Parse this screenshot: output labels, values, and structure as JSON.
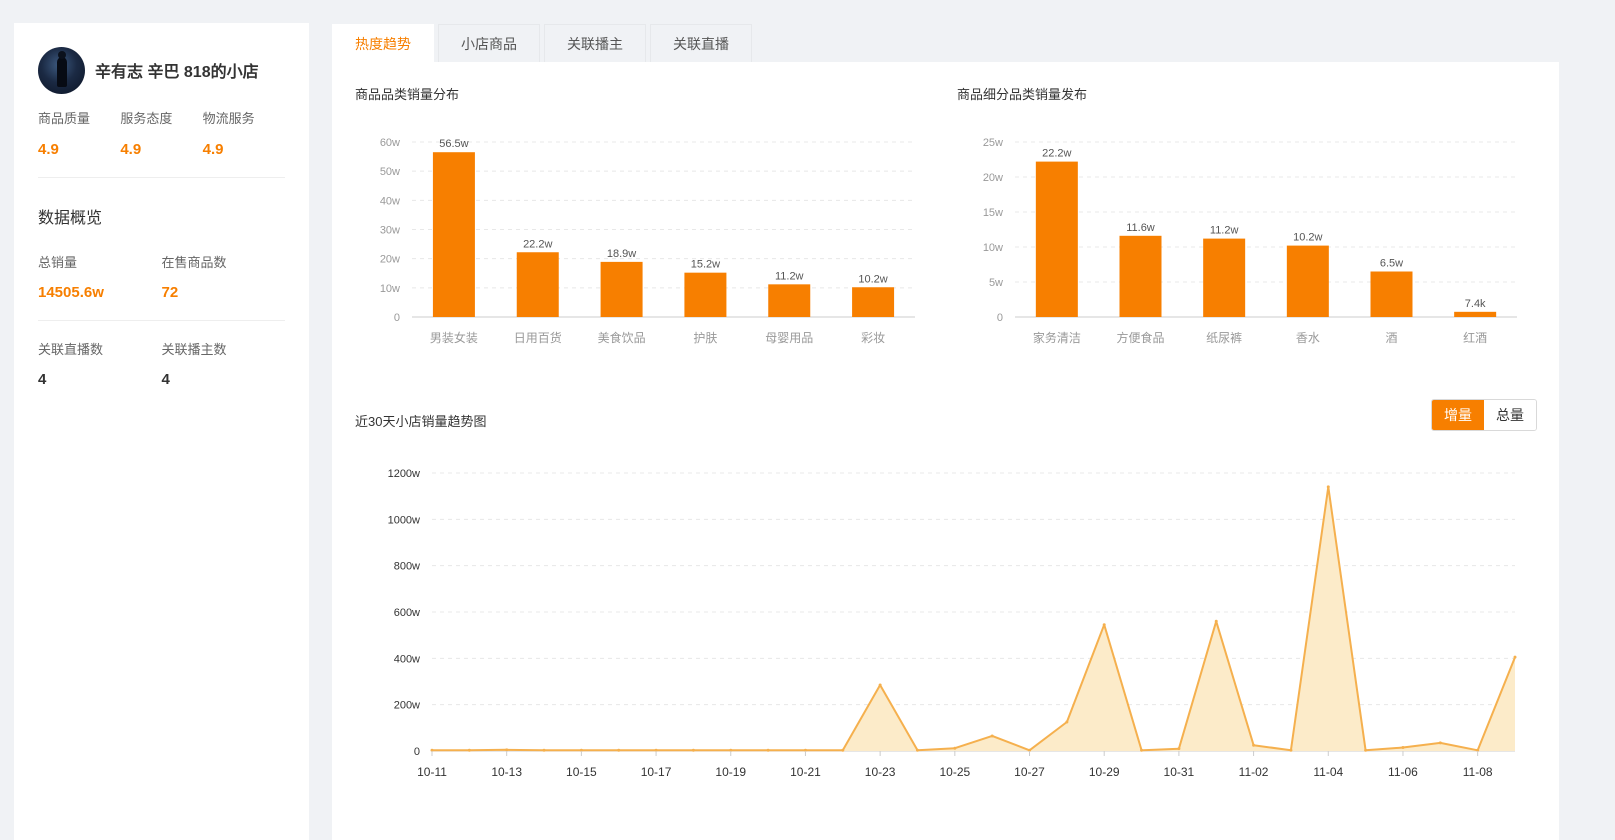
{
  "shop": {
    "name": "辛有志 辛巴 818的小店",
    "scores": [
      {
        "label": "商品质量",
        "value": "4.9"
      },
      {
        "label": "服务态度",
        "value": "4.9"
      },
      {
        "label": "物流服务",
        "value": "4.9"
      }
    ]
  },
  "overview": {
    "title": "数据概览",
    "total_sales_label": "总销量",
    "total_sales_value": "14505.6w",
    "on_sale_label": "在售商品数",
    "on_sale_value": "72",
    "linked_live_label": "关联直播数",
    "linked_live_value": "4",
    "linked_host_label": "关联播主数",
    "linked_host_value": "4"
  },
  "tabs": [
    "热度趋势",
    "小店商品",
    "关联播主",
    "关联直播"
  ],
  "active_tab": 0,
  "toggle": {
    "increment": "增量",
    "total": "总量"
  },
  "colors": {
    "accent": "#f77f00",
    "area_stroke": "#f5b04e",
    "area_fill": "#fcebc9"
  },
  "chart_data": [
    {
      "type": "bar",
      "title": "商品品类销量分布",
      "categories": [
        "男装女装",
        "日用百货",
        "美食饮品",
        "护肤",
        "母婴用品",
        "彩妆"
      ],
      "values": [
        56.5,
        22.2,
        18.9,
        15.2,
        11.2,
        10.2
      ],
      "data_labels": [
        "56.5w",
        "22.2w",
        "18.9w",
        "15.2w",
        "11.2w",
        "10.2w"
      ],
      "ylim": [
        0,
        60
      ],
      "yticks": [
        0,
        10,
        20,
        30,
        40,
        50,
        60
      ],
      "ytick_labels": [
        "0",
        "10w",
        "20w",
        "30w",
        "40w",
        "50w",
        "60w"
      ],
      "grid": true
    },
    {
      "type": "bar",
      "title": "商品细分品类销量发布",
      "categories": [
        "家务清洁",
        "方便食品",
        "纸尿裤",
        "香水",
        "酒",
        "红酒"
      ],
      "values": [
        22.2,
        11.6,
        11.2,
        10.2,
        6.5,
        0.74
      ],
      "data_labels": [
        "22.2w",
        "11.6w",
        "11.2w",
        "10.2w",
        "6.5w",
        "7.4k"
      ],
      "ylim": [
        0,
        25
      ],
      "yticks": [
        0,
        5,
        10,
        15,
        20,
        25
      ],
      "ytick_labels": [
        "0",
        "5w",
        "10w",
        "15w",
        "20w",
        "25w"
      ],
      "grid": true
    },
    {
      "type": "area",
      "title": "近30天小店销量趋势图",
      "x": [
        "10-11",
        "10-12",
        "10-13",
        "10-14",
        "10-15",
        "10-16",
        "10-17",
        "10-18",
        "10-19",
        "10-20",
        "10-21",
        "10-22",
        "10-23",
        "10-24",
        "10-25",
        "10-26",
        "10-27",
        "10-28",
        "10-29",
        "10-30",
        "10-31",
        "11-01",
        "11-02",
        "11-03",
        "11-04",
        "11-05",
        "11-06",
        "11-07",
        "11-08",
        "11-09"
      ],
      "xtick_labels": [
        "10-11",
        "10-13",
        "10-15",
        "10-17",
        "10-19",
        "10-21",
        "10-23",
        "10-25",
        "10-27",
        "10-29",
        "10-31",
        "11-02",
        "11-04",
        "11-06",
        "11-08"
      ],
      "values": [
        3,
        3,
        5,
        3,
        3,
        3,
        3,
        3,
        3,
        3,
        3,
        3,
        285,
        3,
        12,
        65,
        3,
        125,
        545,
        3,
        10,
        560,
        25,
        3,
        1140,
        3,
        15,
        35,
        3,
        405
      ],
      "ylim": [
        0,
        1200
      ],
      "yticks": [
        0,
        200,
        400,
        600,
        800,
        1000,
        1200
      ],
      "ytick_labels": [
        "0",
        "200w",
        "400w",
        "600w",
        "800w",
        "1000w",
        "1200w"
      ],
      "grid": true
    }
  ]
}
